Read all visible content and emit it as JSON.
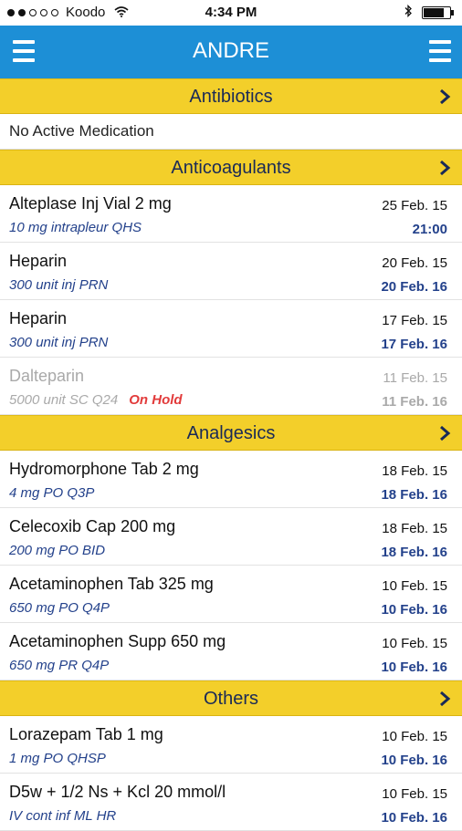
{
  "status_bar": {
    "carrier": "Koodo",
    "time": "4:34 PM"
  },
  "navbar": {
    "title": "ANDRE"
  },
  "sections": {
    "antibiotics": {
      "title": "Antibiotics",
      "empty_text": "No Active Medication"
    },
    "anticoagulants": {
      "title": "Anticoagulants",
      "items": [
        {
          "name": "Alteplase Inj Vial 2 mg",
          "dose": "10 mg intrapleur QHS",
          "start": "25 Feb. 15",
          "end": "21:00"
        },
        {
          "name": "Heparin",
          "dose": "300 unit inj PRN",
          "start": "20 Feb. 15",
          "end": "20 Feb. 16"
        },
        {
          "name": "Heparin",
          "dose": "300 unit inj PRN",
          "start": "17 Feb. 15",
          "end": "17 Feb. 16"
        },
        {
          "name": "Dalteparin",
          "dose": "5000 unit SC Q24",
          "status": "On Hold",
          "start": "11 Feb. 15",
          "end": "11 Feb. 16"
        }
      ]
    },
    "analgesics": {
      "title": "Analgesics",
      "items": [
        {
          "name": "Hydromorphone Tab 2 mg",
          "dose": "4 mg PO Q3P",
          "start": "18 Feb. 15",
          "end": "18 Feb. 16"
        },
        {
          "name": "Celecoxib Cap 200 mg",
          "dose": "200 mg PO BID",
          "start": "18 Feb. 15",
          "end": "18 Feb. 16"
        },
        {
          "name": "Acetaminophen Tab 325 mg",
          "dose": "650 mg PO Q4P",
          "start": "10 Feb. 15",
          "end": "10 Feb. 16"
        },
        {
          "name": "Acetaminophen Supp 650 mg",
          "dose": "650 mg PR Q4P",
          "start": "10 Feb. 15",
          "end": "10 Feb. 16"
        }
      ]
    },
    "others": {
      "title": "Others",
      "items": [
        {
          "name": "Lorazepam Tab 1 mg",
          "dose": "1 mg PO QHSP",
          "start": "10 Feb. 15",
          "end": "10 Feb. 16"
        },
        {
          "name": "D5w + 1/2 Ns + Kcl 20 mmol/l",
          "dose": "IV cont inf ML HR",
          "start": "10 Feb. 15",
          "end": "10 Feb. 16"
        }
      ]
    }
  },
  "colors": {
    "navbar": "#1d8fd6",
    "section": "#f3cf2a",
    "dose_text": "#23418b",
    "on_hold": "#e23b3b"
  }
}
